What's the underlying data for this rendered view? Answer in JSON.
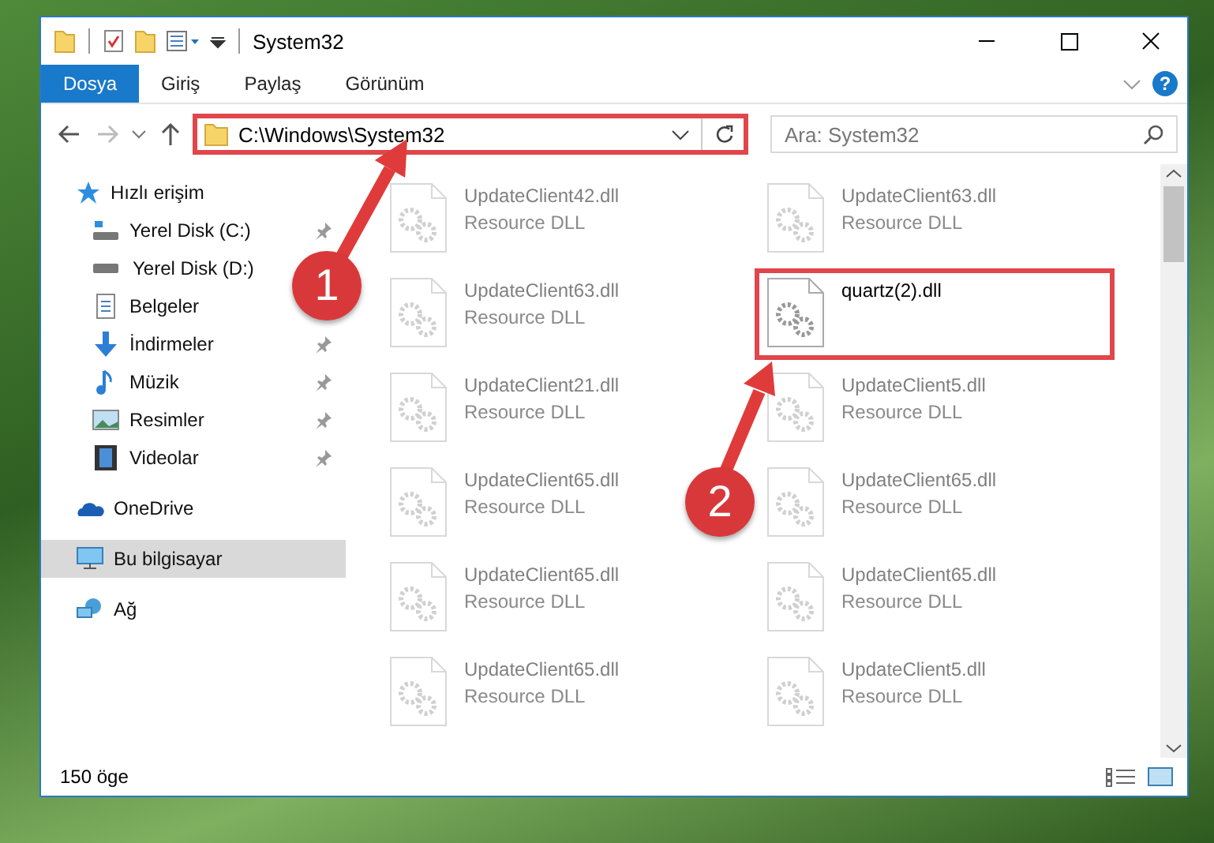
{
  "window": {
    "title": "System32"
  },
  "ribbon": {
    "tabs": [
      {
        "label": "Dosya",
        "selected": true
      },
      {
        "label": "Giriş",
        "selected": false
      },
      {
        "label": "Paylaş",
        "selected": false
      },
      {
        "label": "Görünüm",
        "selected": false
      }
    ],
    "help_label": "?"
  },
  "address": {
    "path": "C:\\Windows\\System32",
    "highlighted": true
  },
  "search": {
    "placeholder": "Ara: System32"
  },
  "sidebar": {
    "items": [
      {
        "label": "Hızlı erişim",
        "selected": false,
        "children": [
          {
            "label": "Yerel Disk (C:)",
            "pinned": true,
            "selected": false
          },
          {
            "label": "Yerel Disk (D:)",
            "pinned": false,
            "selected": false
          },
          {
            "label": "Belgeler",
            "pinned": false,
            "selected": false
          },
          {
            "label": "İndirmeler",
            "pinned": true,
            "selected": false
          },
          {
            "label": "Müzik",
            "pinned": true,
            "selected": false
          },
          {
            "label": "Resimler",
            "pinned": true,
            "selected": false
          },
          {
            "label": "Videolar",
            "pinned": true,
            "selected": false
          }
        ]
      },
      {
        "label": "OneDrive",
        "selected": false
      },
      {
        "label": "Bu bilgisayar",
        "selected": true
      },
      {
        "label": "Ağ",
        "selected": false
      }
    ]
  },
  "files": [
    {
      "name": "UpdateClient42.dll",
      "type": "Resource DLL",
      "dimmed": true,
      "highlighted": false
    },
    {
      "name": "UpdateClient63.dll",
      "type": "Resource DLL",
      "dimmed": true,
      "highlighted": false
    },
    {
      "name": "UpdateClient63.dll",
      "type": "Resource DLL",
      "dimmed": true,
      "highlighted": false
    },
    {
      "name": "quartz(2).dll",
      "dimmed": false,
      "highlighted": true
    },
    {
      "name": "UpdateClient21.dll",
      "type": "Resource DLL",
      "dimmed": true,
      "highlighted": false
    },
    {
      "name": "UpdateClient5.dll",
      "type": "Resource DLL",
      "dimmed": true,
      "highlighted": false
    },
    {
      "name": "UpdateClient65.dll",
      "type": "Resource DLL",
      "dimmed": true,
      "highlighted": false
    },
    {
      "name": "UpdateClient65.dll",
      "type": "Resource DLL",
      "dimmed": true,
      "highlighted": false
    },
    {
      "name": "UpdateClient65.dll",
      "type": "Resource DLL",
      "dimmed": true,
      "highlighted": false
    },
    {
      "name": "UpdateClient65.dll",
      "type": "Resource DLL",
      "dimmed": true,
      "highlighted": false
    },
    {
      "name": "UpdateClient65.dll",
      "type": "Resource DLL",
      "dimmed": true,
      "highlighted": false
    },
    {
      "name": "UpdateClient5.dll",
      "type": "Resource DLL",
      "dimmed": true,
      "highlighted": false
    }
  ],
  "status_bar": {
    "count": "150 öge"
  },
  "annotations": [
    {
      "label": "1"
    },
    {
      "label": "2"
    }
  ]
}
